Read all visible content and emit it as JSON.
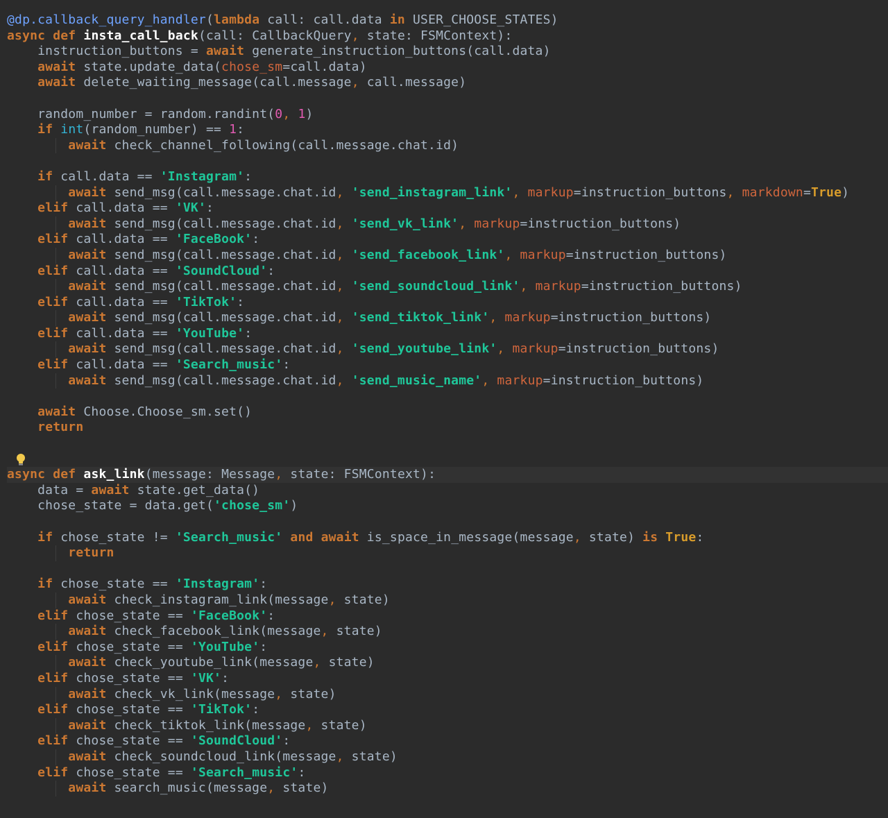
{
  "editor": {
    "theme": "dark",
    "colors": {
      "background": "#2b2b2b",
      "keyword": "#cc7832",
      "string": "#1fc79a",
      "param": "#d0663d",
      "number": "#e25bb3",
      "decorator": "#6fa3ff"
    },
    "icons": {
      "intention": "lightbulb-icon"
    }
  },
  "lines": [
    [
      [
        "decorator",
        "@dp.callback_query_handler"
      ],
      [
        "plain",
        "("
      ],
      [
        "kw",
        "lambda"
      ],
      [
        "plain",
        " call: call.data "
      ],
      [
        "kw",
        "in"
      ],
      [
        "plain",
        " USER_CHOOSE_STATES)"
      ]
    ],
    [
      [
        "kw",
        "async"
      ],
      [
        "plain",
        " "
      ],
      [
        "kw",
        "def"
      ],
      [
        "plain",
        " "
      ],
      [
        "fn",
        "insta_call_back"
      ],
      [
        "plain",
        "(call: CallbackQuery"
      ],
      [
        "punct",
        ","
      ],
      [
        "plain",
        " state: FSMContext):"
      ]
    ],
    [
      [
        "plain",
        "    instruction_buttons = "
      ],
      [
        "kw",
        "await"
      ],
      [
        "plain",
        " generate_instruction_buttons(call.data)"
      ]
    ],
    [
      [
        "plain",
        "    "
      ],
      [
        "kw",
        "await"
      ],
      [
        "plain",
        " state.update_data("
      ],
      [
        "param",
        "chose_sm"
      ],
      [
        "plain",
        "=call.data)"
      ]
    ],
    [
      [
        "plain",
        "    "
      ],
      [
        "kw",
        "await"
      ],
      [
        "plain",
        " delete_waiting_message(call.message"
      ],
      [
        "punct",
        ","
      ],
      [
        "plain",
        " call.message)"
      ]
    ],
    [],
    [
      [
        "plain",
        "    random_number = random.randint("
      ],
      [
        "num",
        "0"
      ],
      [
        "punct",
        ","
      ],
      [
        "plain",
        " "
      ],
      [
        "num",
        "1"
      ],
      [
        "plain",
        ")"
      ]
    ],
    [
      [
        "plain",
        "    "
      ],
      [
        "kw",
        "if"
      ],
      [
        "plain",
        " "
      ],
      [
        "builtin",
        "int"
      ],
      [
        "plain",
        "(random_number) == "
      ],
      [
        "num",
        "1"
      ],
      [
        "plain",
        ":"
      ]
    ],
    [
      [
        "plain",
        "        "
      ],
      [
        "kw",
        "await"
      ],
      [
        "plain",
        " check_channel_following(call.message.chat.id)"
      ]
    ],
    [],
    [
      [
        "plain",
        "    "
      ],
      [
        "kw",
        "if"
      ],
      [
        "plain",
        " call.data == "
      ],
      [
        "str",
        "'Instagram'"
      ],
      [
        "plain",
        ":"
      ]
    ],
    [
      [
        "plain",
        "        "
      ],
      [
        "kw",
        "await"
      ],
      [
        "plain",
        " send_msg(call.message.chat.id"
      ],
      [
        "punct",
        ","
      ],
      [
        "plain",
        " "
      ],
      [
        "str",
        "'send_instagram_link'"
      ],
      [
        "punct",
        ","
      ],
      [
        "plain",
        " "
      ],
      [
        "param",
        "markup"
      ],
      [
        "plain",
        "=instruction_buttons"
      ],
      [
        "punct",
        ","
      ],
      [
        "plain",
        " "
      ],
      [
        "param",
        "markdown"
      ],
      [
        "plain",
        "="
      ],
      [
        "true",
        "True"
      ],
      [
        "plain",
        ")"
      ]
    ],
    [
      [
        "plain",
        "    "
      ],
      [
        "kw",
        "elif"
      ],
      [
        "plain",
        " call.data == "
      ],
      [
        "str",
        "'VK'"
      ],
      [
        "plain",
        ":"
      ]
    ],
    [
      [
        "plain",
        "        "
      ],
      [
        "kw",
        "await"
      ],
      [
        "plain",
        " send_msg(call.message.chat.id"
      ],
      [
        "punct",
        ","
      ],
      [
        "plain",
        " "
      ],
      [
        "str",
        "'send_vk_link'"
      ],
      [
        "punct",
        ","
      ],
      [
        "plain",
        " "
      ],
      [
        "param",
        "markup"
      ],
      [
        "plain",
        "=instruction_buttons)"
      ]
    ],
    [
      [
        "plain",
        "    "
      ],
      [
        "kw",
        "elif"
      ],
      [
        "plain",
        " call.data == "
      ],
      [
        "str",
        "'FaceBook'"
      ],
      [
        "plain",
        ":"
      ]
    ],
    [
      [
        "plain",
        "        "
      ],
      [
        "kw",
        "await"
      ],
      [
        "plain",
        " send_msg(call.message.chat.id"
      ],
      [
        "punct",
        ","
      ],
      [
        "plain",
        " "
      ],
      [
        "str",
        "'send_facebook_link'"
      ],
      [
        "punct",
        ","
      ],
      [
        "plain",
        " "
      ],
      [
        "param",
        "markup"
      ],
      [
        "plain",
        "=instruction_buttons)"
      ]
    ],
    [
      [
        "plain",
        "    "
      ],
      [
        "kw",
        "elif"
      ],
      [
        "plain",
        " call.data == "
      ],
      [
        "str",
        "'SoundCloud'"
      ],
      [
        "plain",
        ":"
      ]
    ],
    [
      [
        "plain",
        "        "
      ],
      [
        "kw",
        "await"
      ],
      [
        "plain",
        " send_msg(call.message.chat.id"
      ],
      [
        "punct",
        ","
      ],
      [
        "plain",
        " "
      ],
      [
        "str",
        "'send_soundcloud_link'"
      ],
      [
        "punct",
        ","
      ],
      [
        "plain",
        " "
      ],
      [
        "param",
        "markup"
      ],
      [
        "plain",
        "=instruction_buttons)"
      ]
    ],
    [
      [
        "plain",
        "    "
      ],
      [
        "kw",
        "elif"
      ],
      [
        "plain",
        " call.data == "
      ],
      [
        "str",
        "'TikTok'"
      ],
      [
        "plain",
        ":"
      ]
    ],
    [
      [
        "plain",
        "        "
      ],
      [
        "kw",
        "await"
      ],
      [
        "plain",
        " send_msg(call.message.chat.id"
      ],
      [
        "punct",
        ","
      ],
      [
        "plain",
        " "
      ],
      [
        "str",
        "'send_tiktok_link'"
      ],
      [
        "punct",
        ","
      ],
      [
        "plain",
        " "
      ],
      [
        "param",
        "markup"
      ],
      [
        "plain",
        "=instruction_buttons)"
      ]
    ],
    [
      [
        "plain",
        "    "
      ],
      [
        "kw",
        "elif"
      ],
      [
        "plain",
        " call.data == "
      ],
      [
        "str",
        "'YouTube'"
      ],
      [
        "plain",
        ":"
      ]
    ],
    [
      [
        "plain",
        "        "
      ],
      [
        "kw",
        "await"
      ],
      [
        "plain",
        " send_msg(call.message.chat.id"
      ],
      [
        "punct",
        ","
      ],
      [
        "plain",
        " "
      ],
      [
        "str",
        "'send_youtube_link'"
      ],
      [
        "punct",
        ","
      ],
      [
        "plain",
        " "
      ],
      [
        "param",
        "markup"
      ],
      [
        "plain",
        "=instruction_buttons)"
      ]
    ],
    [
      [
        "plain",
        "    "
      ],
      [
        "kw",
        "elif"
      ],
      [
        "plain",
        " call.data == "
      ],
      [
        "str",
        "'Search_music'"
      ],
      [
        "plain",
        ":"
      ]
    ],
    [
      [
        "plain",
        "        "
      ],
      [
        "kw",
        "await"
      ],
      [
        "plain",
        " send_msg(call.message.chat.id"
      ],
      [
        "punct",
        ","
      ],
      [
        "plain",
        " "
      ],
      [
        "str",
        "'send_music_name'"
      ],
      [
        "punct",
        ","
      ],
      [
        "plain",
        " "
      ],
      [
        "param",
        "markup"
      ],
      [
        "plain",
        "=instruction_buttons)"
      ]
    ],
    [],
    [
      [
        "plain",
        "    "
      ],
      [
        "kw",
        "await"
      ],
      [
        "plain",
        " Choose.Choose_sm.set()"
      ]
    ],
    [
      [
        "plain",
        "    "
      ],
      [
        "kw",
        "return"
      ]
    ],
    [],
    [],
    [
      [
        "kw",
        "async"
      ],
      [
        "plain",
        " "
      ],
      [
        "kw",
        "def"
      ],
      [
        "plain",
        " "
      ],
      [
        "fn",
        "ask_link"
      ],
      [
        "plain",
        "(message: Message"
      ],
      [
        "punct",
        ","
      ],
      [
        "plain",
        " state: FSMContext):"
      ]
    ],
    [
      [
        "plain",
        "    data = "
      ],
      [
        "kw",
        "await"
      ],
      [
        "plain",
        " state.get_data()"
      ]
    ],
    [
      [
        "plain",
        "    chose_state = data.get("
      ],
      [
        "str",
        "'chose_sm'"
      ],
      [
        "plain",
        ")"
      ]
    ],
    [],
    [
      [
        "plain",
        "    "
      ],
      [
        "kw",
        "if"
      ],
      [
        "plain",
        " chose_state != "
      ],
      [
        "str",
        "'Search_music'"
      ],
      [
        "plain",
        " "
      ],
      [
        "kw",
        "and"
      ],
      [
        "plain",
        " "
      ],
      [
        "kw",
        "await"
      ],
      [
        "plain",
        " is_space_in_message(message"
      ],
      [
        "punct",
        ","
      ],
      [
        "plain",
        " state) "
      ],
      [
        "kw",
        "is"
      ],
      [
        "plain",
        " "
      ],
      [
        "true",
        "True"
      ],
      [
        "plain",
        ":"
      ]
    ],
    [
      [
        "plain",
        "        "
      ],
      [
        "kw",
        "return"
      ]
    ],
    [],
    [
      [
        "plain",
        "    "
      ],
      [
        "kw",
        "if"
      ],
      [
        "plain",
        " chose_state == "
      ],
      [
        "str",
        "'Instagram'"
      ],
      [
        "plain",
        ":"
      ]
    ],
    [
      [
        "plain",
        "        "
      ],
      [
        "kw",
        "await"
      ],
      [
        "plain",
        " check_instagram_link(message"
      ],
      [
        "punct",
        ","
      ],
      [
        "plain",
        " state)"
      ]
    ],
    [
      [
        "plain",
        "    "
      ],
      [
        "kw",
        "elif"
      ],
      [
        "plain",
        " chose_state == "
      ],
      [
        "str",
        "'FaceBook'"
      ],
      [
        "plain",
        ":"
      ]
    ],
    [
      [
        "plain",
        "        "
      ],
      [
        "kw",
        "await"
      ],
      [
        "plain",
        " check_facebook_link(message"
      ],
      [
        "punct",
        ","
      ],
      [
        "plain",
        " state)"
      ]
    ],
    [
      [
        "plain",
        "    "
      ],
      [
        "kw",
        "elif"
      ],
      [
        "plain",
        " chose_state == "
      ],
      [
        "str",
        "'YouTube'"
      ],
      [
        "plain",
        ":"
      ]
    ],
    [
      [
        "plain",
        "        "
      ],
      [
        "kw",
        "await"
      ],
      [
        "plain",
        " check_youtube_link(message"
      ],
      [
        "punct",
        ","
      ],
      [
        "plain",
        " state)"
      ]
    ],
    [
      [
        "plain",
        "    "
      ],
      [
        "kw",
        "elif"
      ],
      [
        "plain",
        " chose_state == "
      ],
      [
        "str",
        "'VK'"
      ],
      [
        "plain",
        ":"
      ]
    ],
    [
      [
        "plain",
        "        "
      ],
      [
        "kw",
        "await"
      ],
      [
        "plain",
        " check_vk_link(message"
      ],
      [
        "punct",
        ","
      ],
      [
        "plain",
        " state)"
      ]
    ],
    [
      [
        "plain",
        "    "
      ],
      [
        "kw",
        "elif"
      ],
      [
        "plain",
        " chose_state == "
      ],
      [
        "str",
        "'TikTok'"
      ],
      [
        "plain",
        ":"
      ]
    ],
    [
      [
        "plain",
        "        "
      ],
      [
        "kw",
        "await"
      ],
      [
        "plain",
        " check_tiktok_link(message"
      ],
      [
        "punct",
        ","
      ],
      [
        "plain",
        " state)"
      ]
    ],
    [
      [
        "plain",
        "    "
      ],
      [
        "kw",
        "elif"
      ],
      [
        "plain",
        " chose_state == "
      ],
      [
        "str",
        "'SoundCloud'"
      ],
      [
        "plain",
        ":"
      ]
    ],
    [
      [
        "plain",
        "        "
      ],
      [
        "kw",
        "await"
      ],
      [
        "plain",
        " check_soundcloud_link(message"
      ],
      [
        "punct",
        ","
      ],
      [
        "plain",
        " state)"
      ]
    ],
    [
      [
        "plain",
        "    "
      ],
      [
        "kw",
        "elif"
      ],
      [
        "plain",
        " chose_state == "
      ],
      [
        "str",
        "'Search_music'"
      ],
      [
        "plain",
        ":"
      ]
    ],
    [
      [
        "plain",
        "        "
      ],
      [
        "kw",
        "await"
      ],
      [
        "plain",
        " search_music(message"
      ],
      [
        "punct",
        ","
      ],
      [
        "plain",
        " state)"
      ]
    ]
  ]
}
